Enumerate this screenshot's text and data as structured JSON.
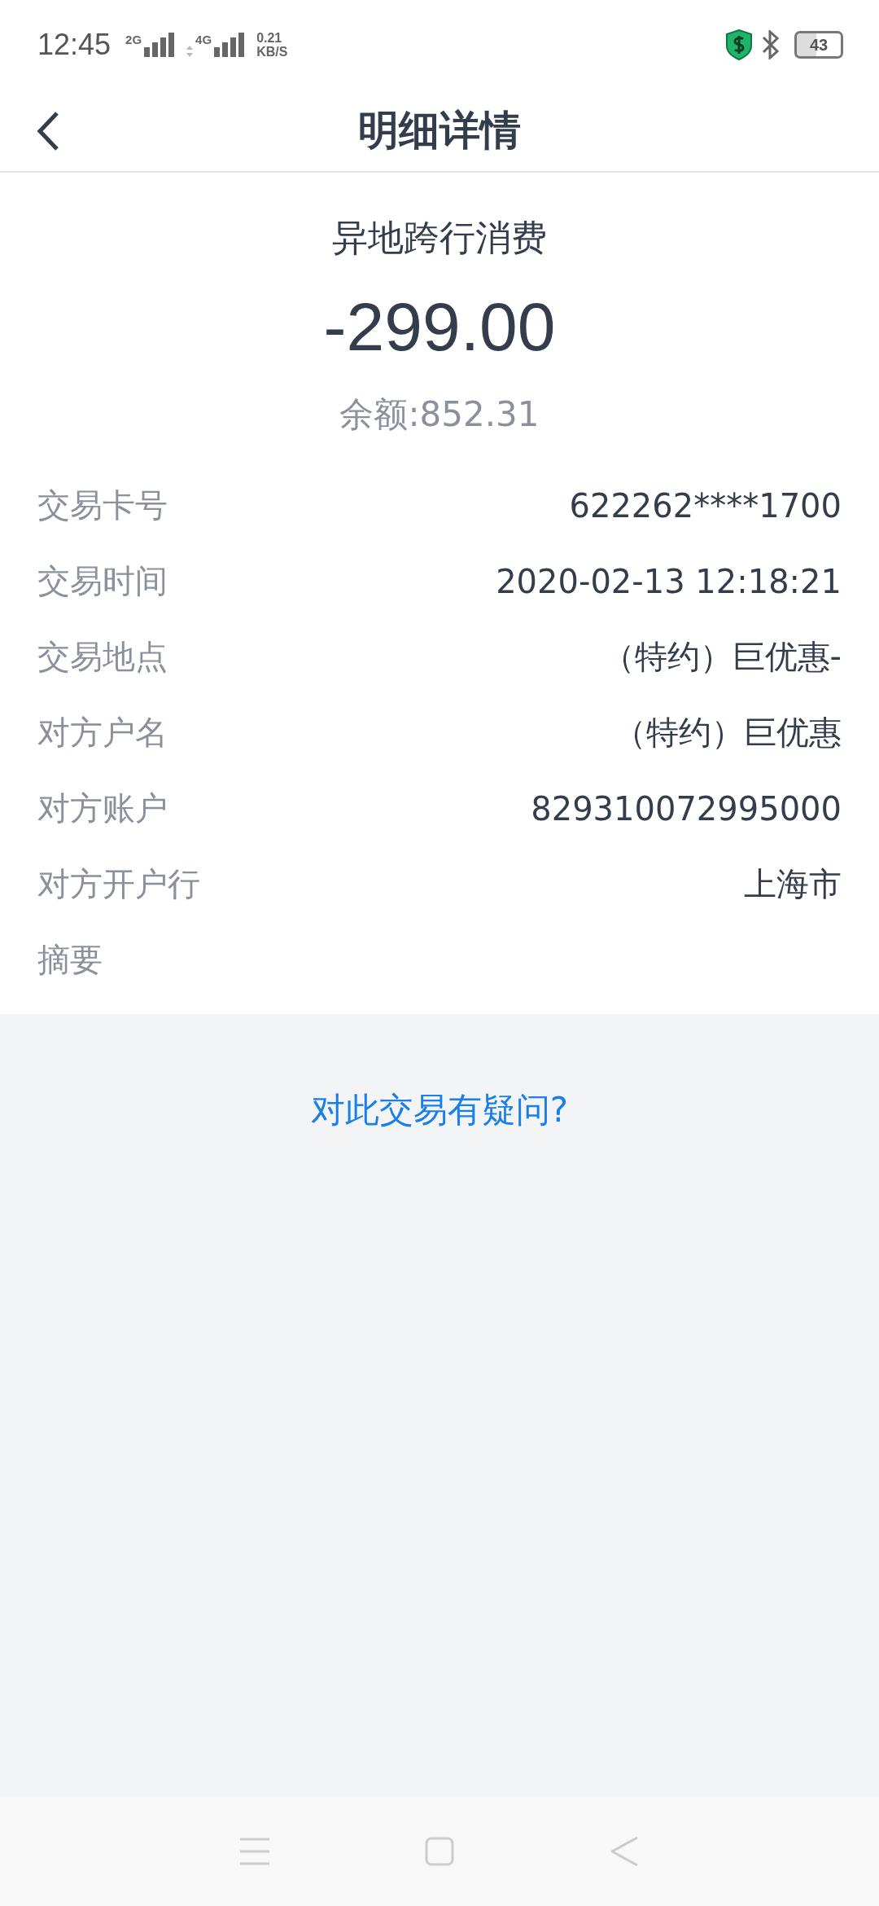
{
  "status_bar": {
    "time": "12:45",
    "sim1": "2G",
    "sim2": "4G",
    "speed": "0.21",
    "speed_unit": "KB/S",
    "battery": "43"
  },
  "header": {
    "title": "明细详情"
  },
  "summary": {
    "type": "异地跨行消费",
    "amount": "-299.00",
    "balance": "余额:852.31"
  },
  "details": [
    {
      "label": "交易卡号",
      "value": "622262****1700"
    },
    {
      "label": "交易时间",
      "value": "2020-02-13 12:18:21"
    },
    {
      "label": "交易地点",
      "value": "（特约）巨优惠-"
    },
    {
      "label": "对方户名",
      "value": "（特约）巨优惠"
    },
    {
      "label": "对方账户",
      "value": "829310072995000"
    },
    {
      "label": "对方开户行",
      "value": "上海市"
    },
    {
      "label": "摘要"
    }
  ],
  "question_link": "对此交易有疑问?"
}
